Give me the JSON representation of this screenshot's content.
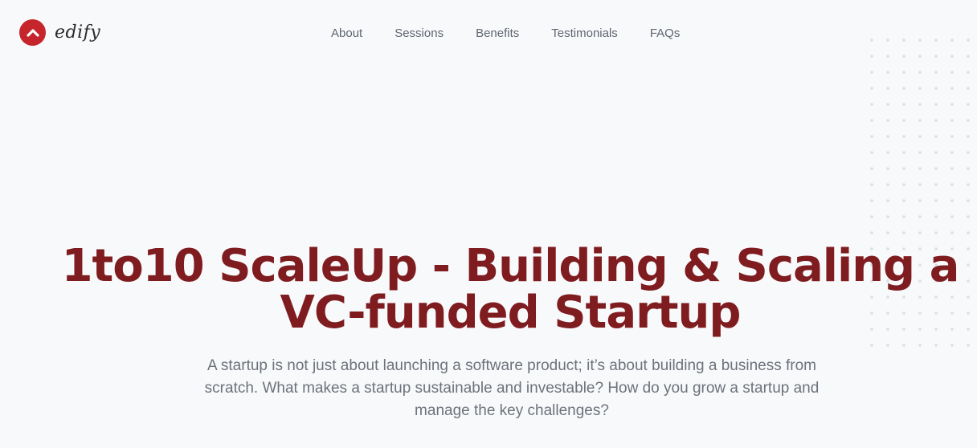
{
  "brand": {
    "name": "edify",
    "color": "#c6262b"
  },
  "nav": {
    "items": [
      {
        "label": "About"
      },
      {
        "label": "Sessions"
      },
      {
        "label": "Benefits"
      },
      {
        "label": "Testimonials"
      },
      {
        "label": "FAQs"
      }
    ]
  },
  "hero": {
    "title": "1to10 ScaleUp - Building & Scaling a VC-funded Startup",
    "subtitle": "A startup is not just about launching a software product; it’s about building a business from scratch. What makes a startup sustainable and investable? How do you grow a startup and manage the key challenges?",
    "title_color": "#7f1c1f"
  },
  "icons": {
    "logo": "chevron-up-icon"
  }
}
